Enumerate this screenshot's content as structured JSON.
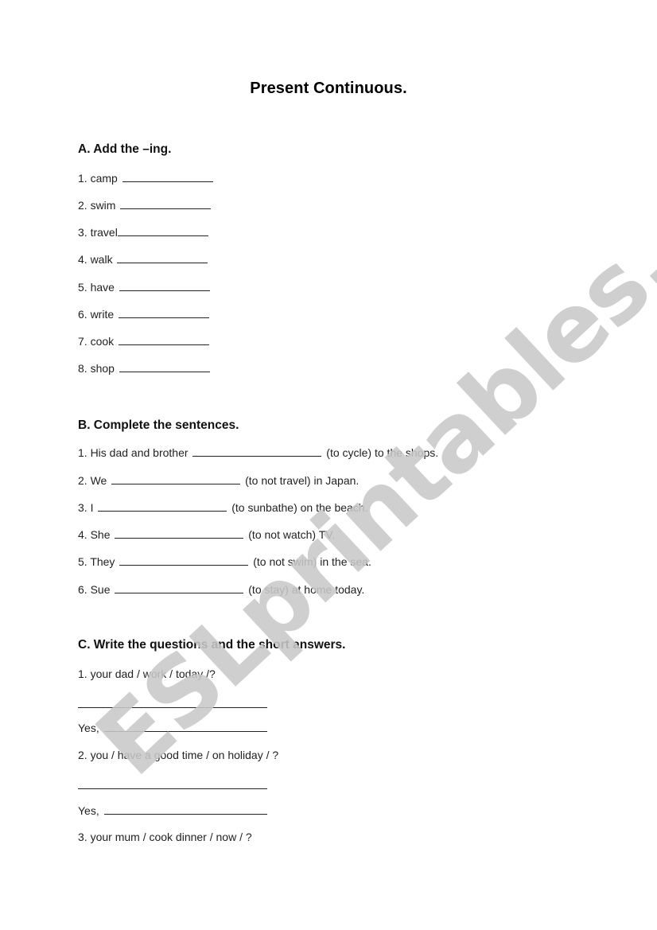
{
  "title": "Present Continuous.",
  "watermark": "ESLprintables.com",
  "section_a": {
    "heading": "A. Add the –ing.",
    "items": [
      {
        "label": "1. camp ",
        "blank_width": 116
      },
      {
        "label": "2. swim ",
        "blank_width": 116
      },
      {
        "label": "3. travel",
        "blank_width": 116
      },
      {
        "label": "4. walk ",
        "blank_width": 116
      },
      {
        "label": "5. have ",
        "blank_width": 116
      },
      {
        "label": "6. write ",
        "blank_width": 116
      },
      {
        "label": "7. cook ",
        "blank_width": 116
      },
      {
        "label": "8. shop ",
        "blank_width": 116
      }
    ]
  },
  "section_b": {
    "heading": "B. Complete the sentences.",
    "items": [
      {
        "before": "1. His dad and brother ",
        "after": " (to cycle) to the shops."
      },
      {
        "before": "2. We ",
        "after": " (to not travel) in Japan."
      },
      {
        "before": "3. I ",
        "after": " (to sunbathe) on the beach."
      },
      {
        "before": "4. She ",
        "after": " (to not watch) TV."
      },
      {
        "before": "5. They ",
        "after": " (to not swim) in the sea."
      },
      {
        "before": "6. Sue ",
        "after": " (to stay) at home today."
      }
    ]
  },
  "section_c": {
    "heading": "C. Write the questions and the short answers.",
    "items": [
      {
        "prompt": "1. your dad / work / today /?",
        "answer_prefix": "Yes, "
      },
      {
        "prompt": "2. you / have a good time / on holiday / ?",
        "answer_prefix": "Yes, "
      },
      {
        "prompt": "3. your mum / cook dinner / now / ?"
      }
    ]
  }
}
